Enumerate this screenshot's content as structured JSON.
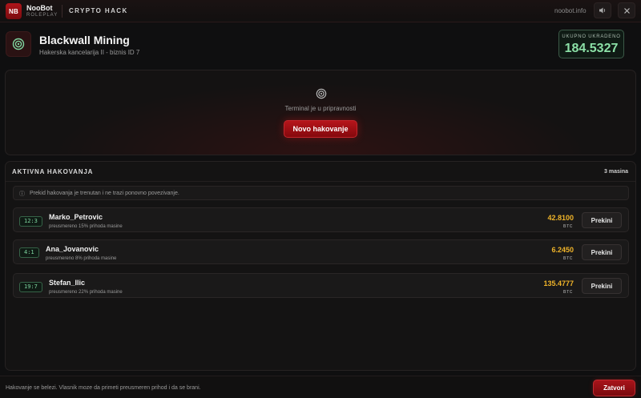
{
  "topbar": {
    "logo_text": "NB",
    "brand_name": "NooBot",
    "brand_sub": "ROLEPLAY",
    "app_title": "CRYPTO HACK",
    "site_url": "noobot.info",
    "sound_icon": "speaker-icon",
    "close_icon": "close-icon",
    "close_glyph": "✕",
    "sound_glyph": "🔈"
  },
  "header": {
    "icon": "target-icon",
    "business_name": "Blackwall Mining",
    "business_sub": "Hakerska kancelarija II - biznis ID 7",
    "total_label": "UKUPNO UKRADENO",
    "total_value": "184.5327"
  },
  "terminal": {
    "icon": "target-icon",
    "status": "Terminal je u pripravnosti",
    "new_hack_label": "Novo hakovanje"
  },
  "active": {
    "title": "AKTIVNA HAKOVANJA",
    "count": "3 masina",
    "info_icon": "info-icon",
    "info_glyph": "ⓘ",
    "info_text": "Prekid hakovanja je trenutan i ne trazi ponovno povezivanje.",
    "rows": [
      {
        "tag": "12:3",
        "player": "Marko_Petrovic",
        "redirect": "preusmereno 15% prihoda masine",
        "amount": "42.8100",
        "unit": "BTC",
        "stop_label": "Prekini"
      },
      {
        "tag": "4:1",
        "player": "Ana_Jovanovic",
        "redirect": "preusmereno 8% prihoda masine",
        "amount": "6.2450",
        "unit": "BTC",
        "stop_label": "Prekini"
      },
      {
        "tag": "19:7",
        "player": "Stefan_Ilic",
        "redirect": "preusmereno 22% prihoda masine",
        "amount": "135.4777",
        "unit": "BTC",
        "stop_label": "Prekini"
      }
    ]
  },
  "footer": {
    "text": "Hakovanje se belezi. Vlasnik moze da primeti preusmeren prihod i da se brani.",
    "close_label": "Zatvori"
  },
  "colors": {
    "accent_red": "#b5151b",
    "money_green": "#8be0a6",
    "amount_gold": "#f0b429"
  }
}
